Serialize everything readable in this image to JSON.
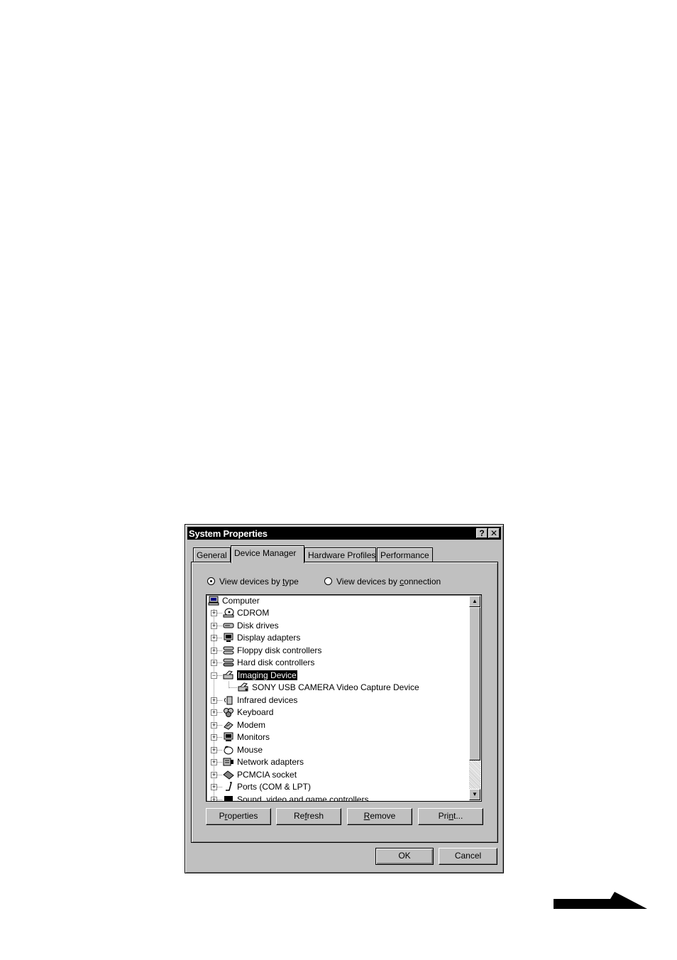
{
  "window": {
    "title": "System Properties",
    "help_glyph": "?",
    "close_glyph": "✕"
  },
  "tabs": [
    {
      "label": "General",
      "active": false
    },
    {
      "label": "Device Manager",
      "active": true
    },
    {
      "label": "Hardware Profiles",
      "active": false
    },
    {
      "label": "Performance",
      "active": false
    }
  ],
  "view_options": {
    "by_type": {
      "prefix": "View devices by ",
      "accel": "t",
      "suffix": "ype",
      "selected": true
    },
    "by_connection": {
      "prefix": "View devices by ",
      "accel": "c",
      "suffix": "onnection",
      "selected": false
    }
  },
  "tree": {
    "root": {
      "label": "Computer",
      "icon": "computer-icon"
    },
    "items": [
      {
        "label": "CDROM",
        "icon": "cdrom-icon",
        "expanded": false
      },
      {
        "label": "Disk drives",
        "icon": "disk-drive-icon",
        "expanded": false
      },
      {
        "label": "Display adapters",
        "icon": "display-adapter-icon",
        "expanded": false
      },
      {
        "label": "Floppy disk controllers",
        "icon": "floppy-controller-icon",
        "expanded": false
      },
      {
        "label": "Hard disk controllers",
        "icon": "hard-disk-controller-icon",
        "expanded": false
      },
      {
        "label": "Imaging Device",
        "icon": "imaging-device-icon",
        "expanded": true,
        "selected": true,
        "children": [
          {
            "label": "SONY USB CAMERA Video Capture Device",
            "icon": "camera-icon"
          }
        ]
      },
      {
        "label": "Infrared devices",
        "icon": "infrared-icon",
        "expanded": false
      },
      {
        "label": "Keyboard",
        "icon": "keyboard-icon",
        "expanded": false
      },
      {
        "label": "Modem",
        "icon": "modem-icon",
        "expanded": false
      },
      {
        "label": "Monitors",
        "icon": "monitor-icon",
        "expanded": false
      },
      {
        "label": "Mouse",
        "icon": "mouse-icon",
        "expanded": false
      },
      {
        "label": "Network adapters",
        "icon": "network-adapter-icon",
        "expanded": false
      },
      {
        "label": "PCMCIA socket",
        "icon": "pcmcia-icon",
        "expanded": false
      },
      {
        "label": "Ports (COM & LPT)",
        "icon": "ports-icon",
        "expanded": false
      },
      {
        "label": "Sound, video and game controllers",
        "icon": "sound-icon",
        "expanded": false
      }
    ]
  },
  "buttons": {
    "properties": {
      "before": "P",
      "accel": "r",
      "after": "operties"
    },
    "refresh": {
      "before": "Re",
      "accel": "f",
      "after": "resh"
    },
    "remove": {
      "before": "",
      "accel": "R",
      "after": "emove"
    },
    "print": {
      "before": "Pri",
      "accel": "n",
      "after": "t..."
    },
    "ok": "OK",
    "cancel": "Cancel"
  }
}
